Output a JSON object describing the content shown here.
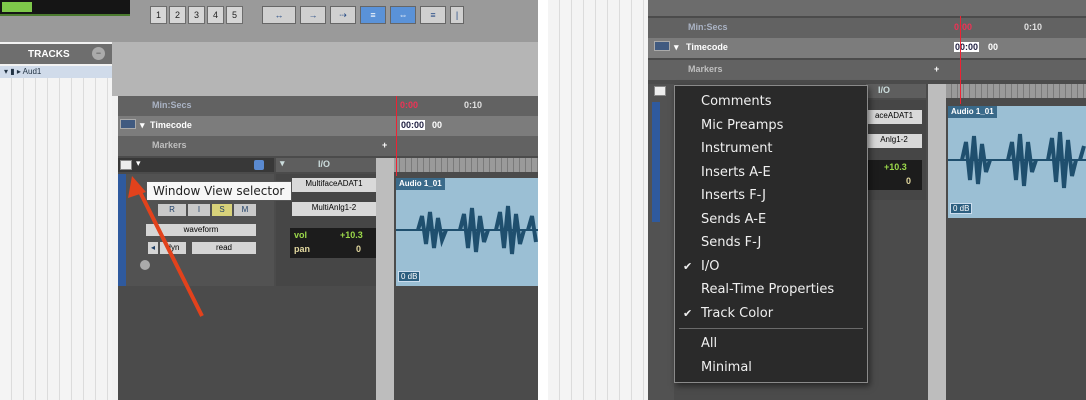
{
  "left": {
    "toolbar": {
      "zoom_presets": [
        "1",
        "2",
        "3",
        "4",
        "5"
      ]
    },
    "tracks_panel": {
      "title": "TRACKS",
      "track_name": "Aud1"
    },
    "rulers": {
      "min_secs_label": "Min:Secs",
      "timecode_label": "Timecode",
      "markers_label": "Markers",
      "tick_0": "0:00",
      "tick_10": "0:10",
      "timecode_value": "00:00",
      "timecode_suffix": "00"
    },
    "io_header": "I/O",
    "track": {
      "input": "MultifaceADAT1",
      "output": "MultiAnlg1-2",
      "waveform_selector": "waveform",
      "view_selector": "dyn",
      "automation": "read",
      "vol_label": "vol",
      "vol_value": "+10.3",
      "pan_label": "pan",
      "pan_value": "0"
    },
    "clip": {
      "name": "Audio 1_01",
      "gain": "0 dB"
    },
    "tooltip": "Window View selector"
  },
  "right": {
    "rulers": {
      "min_secs_label": "Min:Secs",
      "timecode_label": "Timecode",
      "markers_label": "Markers",
      "tick_0": "0:00",
      "tick_10": "0:10",
      "timecode_value": "00:00",
      "timecode_suffix": "00"
    },
    "io_header": "I/O",
    "track": {
      "input": "aceADAT1",
      "output": "Anlg1-2",
      "vol_value": "+10.3",
      "pan_value": "0"
    },
    "clip": {
      "name": "Audio 1_01",
      "gain": "0 dB"
    },
    "menu": {
      "items": [
        {
          "label": "Comments",
          "checked": false
        },
        {
          "label": "Mic Preamps",
          "checked": false
        },
        {
          "label": "Instrument",
          "checked": false
        },
        {
          "label": "Inserts A-E",
          "checked": false
        },
        {
          "label": "Inserts F-J",
          "checked": false
        },
        {
          "label": "Sends A-E",
          "checked": false
        },
        {
          "label": "Sends F-J",
          "checked": false
        },
        {
          "label": "I/O",
          "checked": true
        },
        {
          "label": "Real-Time Properties",
          "checked": false
        },
        {
          "label": "Track Color",
          "checked": true
        }
      ],
      "footer_items": [
        {
          "label": "All"
        },
        {
          "label": "Minimal"
        }
      ],
      "check_glyph": "✔"
    }
  },
  "colors": {
    "arrow": "#e2421c",
    "waveform": "#1f4f6e",
    "clip_bg": "#9bbfd4",
    "selected_button": "#5a92d8"
  }
}
